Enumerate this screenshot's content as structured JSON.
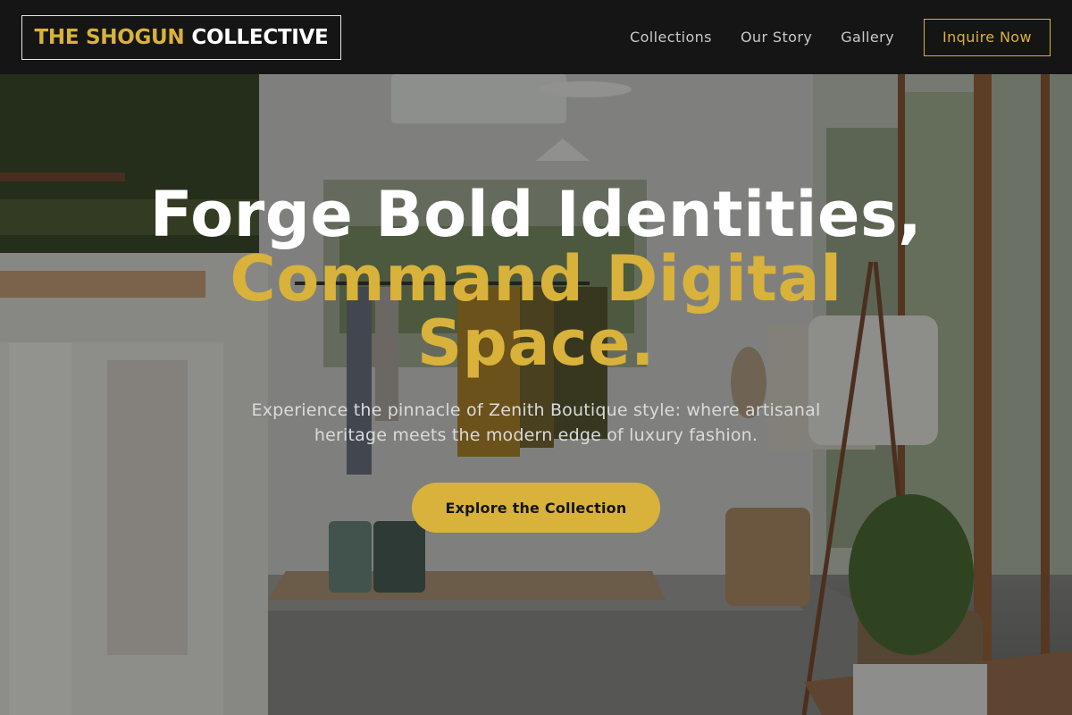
{
  "brand": {
    "part1": "THE SHOGUN",
    "part2": "COLLECTIVE"
  },
  "nav": {
    "links": [
      "Collections",
      "Our Story",
      "Gallery"
    ],
    "cta_label": "Inquire Now"
  },
  "hero": {
    "headline_line1": "Forge Bold Identities,",
    "headline_line2": "Command Digital",
    "headline_line3": "Space.",
    "subtitle": "Experience the pinnacle of Zenith Boutique style: where artisanal heritage meets the modern edge of luxury fashion.",
    "cta_label": "Explore the Collection",
    "background_image": "boutique-interior-photo"
  },
  "colors": {
    "accent": "#d8b23a",
    "nav_background": "#151515",
    "headline_white": "#ffffff",
    "subtext": "#dadada"
  }
}
